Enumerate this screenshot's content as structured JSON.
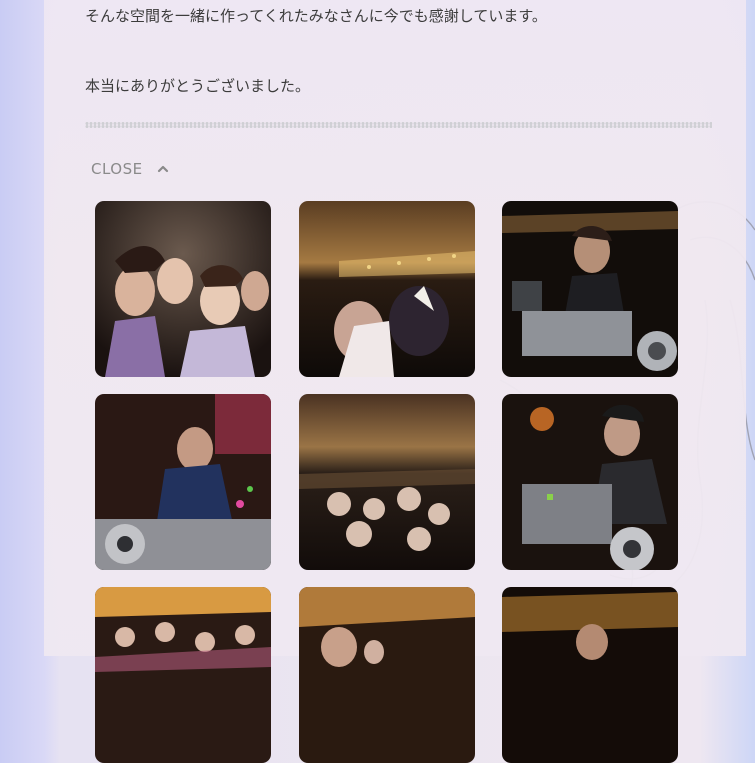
{
  "content": {
    "line1": "そんな空間を一緒に作ってくれたみなさんに今でも感謝しています。",
    "line2": "本当にありがとうございました。"
  },
  "toggle": {
    "label": "CLOSE"
  },
  "gallery": {
    "photos": [
      {
        "subject": "crowd of party guests posing"
      },
      {
        "subject": "party on boat deck with night city skyline"
      },
      {
        "subject": "dj playing at turntables"
      },
      {
        "subject": "dj in yukata at turntables"
      },
      {
        "subject": "crowd on boat deck at night"
      },
      {
        "subject": "dj with headphones and cap at mixer"
      },
      {
        "subject": "crowd dancing indoors"
      },
      {
        "subject": "person on deck at night"
      },
      {
        "subject": "person at night with skyline"
      }
    ]
  }
}
